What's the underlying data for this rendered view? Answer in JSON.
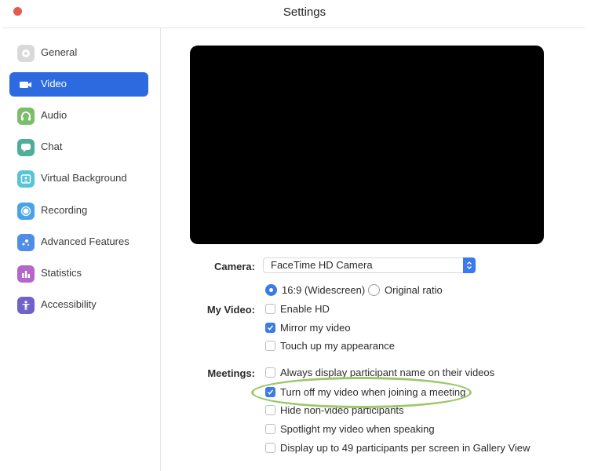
{
  "window": {
    "title": "Settings",
    "close_color": "#e5594f"
  },
  "sidebar": {
    "active_color": "#2d6ae0",
    "items": [
      {
        "label": "General",
        "icon": "gear-icon",
        "icon_color": "#d9d9d9",
        "active": false
      },
      {
        "label": "Video",
        "icon": "video-camera-icon",
        "icon_color": "#2d6ae0",
        "active": true
      },
      {
        "label": "Audio",
        "icon": "headphones-icon",
        "icon_color": "#7cbd6b",
        "active": false
      },
      {
        "label": "Chat",
        "icon": "chat-bubble-icon",
        "icon_color": "#4fae9a",
        "active": false
      },
      {
        "label": "Virtual Background",
        "icon": "person-frame-icon",
        "icon_color": "#59c4d6",
        "active": false
      },
      {
        "label": "Recording",
        "icon": "record-icon",
        "icon_color": "#4aa3e6",
        "active": false
      },
      {
        "label": "Advanced Features",
        "icon": "sparkle-icon",
        "icon_color": "#4f8de6",
        "active": false
      },
      {
        "label": "Statistics",
        "icon": "bar-chart-icon",
        "icon_color": "#b267c9",
        "active": false
      },
      {
        "label": "Accessibility",
        "icon": "accessibility-icon",
        "icon_color": "#6f62c8",
        "active": false
      }
    ]
  },
  "video": {
    "camera": {
      "label": "Camera:",
      "selected": "FaceTime HD Camera"
    },
    "aspect": {
      "options": [
        {
          "label": "16:9 (Widescreen)",
          "selected": true
        },
        {
          "label": "Original ratio",
          "selected": false
        }
      ]
    },
    "my_video": {
      "label": "My Video:",
      "options": [
        {
          "label": "Enable HD",
          "checked": false
        },
        {
          "label": "Mirror my video",
          "checked": true
        },
        {
          "label": "Touch up my appearance",
          "checked": false
        }
      ]
    },
    "meetings": {
      "label": "Meetings:",
      "options": [
        {
          "label": "Always display participant name on their videos",
          "checked": false
        },
        {
          "label": "Turn off my video when joining a meeting",
          "checked": true,
          "highlighted": true
        },
        {
          "label": "Hide non-video participants",
          "checked": false
        },
        {
          "label": "Spotlight my video when speaking",
          "checked": false
        },
        {
          "label": "Display up to 49 participants per screen in Gallery View",
          "checked": false
        }
      ]
    },
    "accent_color": "#3b7ae8",
    "highlight_color": "#9dc86a"
  }
}
